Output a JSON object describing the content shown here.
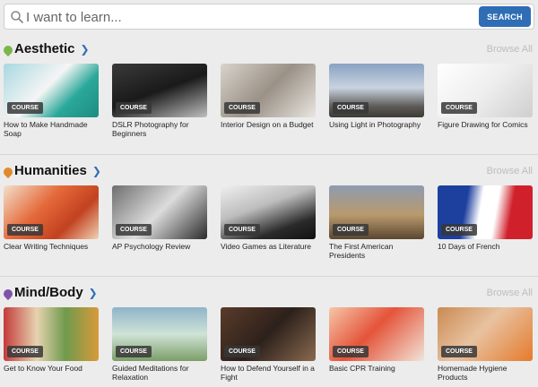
{
  "search": {
    "placeholder": "I want to learn...",
    "button_label": "SEARCH"
  },
  "badge_label": "COURSE",
  "browse_all_label": "Browse All",
  "sections": [
    {
      "title": "Aesthetic",
      "accent": "#7ab648",
      "courses": [
        {
          "title": "How to Make Handmade Soap",
          "bg": "linear-gradient(135deg,#a8d8e0 0%,#f5f5f5 45%,#2aa89a 70%,#1d8c80 100%)"
        },
        {
          "title": "DSLR Photography for Beginners",
          "bg": "linear-gradient(160deg,#3a3a3a 0%,#1a1a1a 50%,#bfbfbf 100%)"
        },
        {
          "title": "Interior Design on a Budget",
          "bg": "linear-gradient(135deg,#d8d4cc 0%,#9a9187 50%,#e9e6e0 100%)"
        },
        {
          "title": "Using Light in Photography",
          "bg": "linear-gradient(180deg,#8aa2c2 0%,#c9d3e0 45%,#5d5a55 80%,#3c3a36 100%)"
        },
        {
          "title": "Figure Drawing for Comics",
          "bg": "linear-gradient(135deg,#ffffff 0%,#eeeeee 50%,#cfcfcf 100%)"
        }
      ]
    },
    {
      "title": "Humanities",
      "accent": "#e08a2c",
      "courses": [
        {
          "title": "Clear Writing Techniques",
          "bg": "linear-gradient(135deg,#f3e0cc 0%,#e56a3a 40%,#c2411f 70%,#efd2b5 100%)"
        },
        {
          "title": "AP Psychology Review",
          "bg": "linear-gradient(135deg,#6e6e6e 0%,#dcdcdc 50%,#2b2b2b 100%)"
        },
        {
          "title": "Video Games as Literature",
          "bg": "linear-gradient(160deg,#f0f0f0 0%,#bdbdbd 40%,#2a2a2a 75%,#111 100%)"
        },
        {
          "title": "The First American Presidents",
          "bg": "linear-gradient(180deg,#8e9bb0 0%,#b99a6d 55%,#5a4630 100%)"
        },
        {
          "title": "10 Days of French",
          "bg": "linear-gradient(100deg,#1d3f9e 0%,#1d3f9e 30%,#ffffff 45%,#ffffff 60%,#d0202b 75%,#d0202b 100%)"
        }
      ]
    },
    {
      "title": "Mind/Body",
      "accent": "#7c55a8",
      "courses": [
        {
          "title": "Get to Know Your Food",
          "bg": "linear-gradient(90deg,#c43b3b 0%,#e6d3b0 35%,#6f9a4c 65%,#d89a3a 100%)"
        },
        {
          "title": "Guided Meditations for Relaxation",
          "bg": "linear-gradient(180deg,#8fb4c9 0%,#cfe3d6 50%,#7c9e68 100%)"
        },
        {
          "title": "How to Defend Yourself in a Fight",
          "bg": "linear-gradient(135deg,#5a3b2a 0%,#2d211b 50%,#8a6a50 100%)"
        },
        {
          "title": "Basic CPR Training",
          "bg": "linear-gradient(135deg,#f6c6a8 0%,#e4543a 45%,#f1e5d8 100%)"
        },
        {
          "title": "Homemade Hygiene Products",
          "bg": "linear-gradient(135deg,#c98a52 0%,#e8c2a0 45%,#e57a2c 100%)"
        }
      ]
    }
  ]
}
